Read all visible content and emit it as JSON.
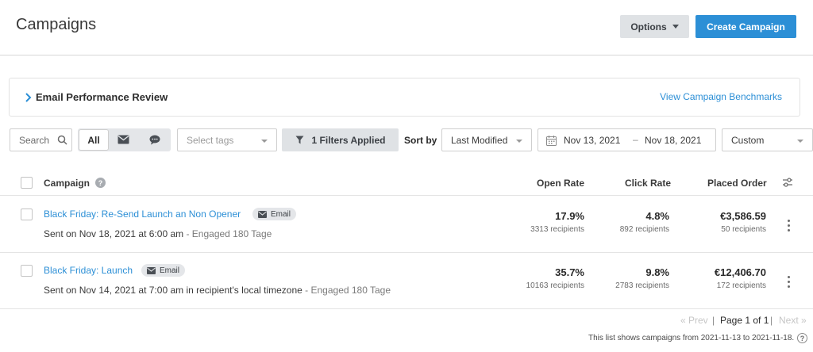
{
  "header": {
    "title": "Campaigns",
    "options_label": "Options",
    "create_label": "Create Campaign"
  },
  "performance": {
    "title": "Email Performance Review",
    "benchmarks_link": "View Campaign Benchmarks"
  },
  "toolbar": {
    "search_placeholder": "Search",
    "channel_all": "All",
    "tags_placeholder": "Select tags",
    "filters_label": "1 Filters Applied",
    "sort_label": "Sort by",
    "sort_value": "Last Modified",
    "date_from": "Nov 13, 2021",
    "date_sep": "–",
    "date_to": "Nov 18, 2021",
    "range_preset": "Custom"
  },
  "table": {
    "columns": {
      "campaign": "Campaign",
      "open_rate": "Open Rate",
      "click_rate": "Click Rate",
      "placed_order": "Placed Order"
    },
    "rows": [
      {
        "name": "Black Friday: Re-Send Launch an Non Opener",
        "channel": "Email",
        "sent": "Sent on Nov 18, 2021 at 6:00 am",
        "engaged": " - Engaged 180 Tage",
        "open_rate": "17.9%",
        "open_recipients": "3313 recipients",
        "click_rate": "4.8%",
        "click_recipients": "892 recipients",
        "placed_order": "€3,586.59",
        "order_recipients": "50 recipients"
      },
      {
        "name": "Black Friday: Launch",
        "channel": "Email",
        "sent": "Sent on Nov 14, 2021 at 7:00 am in recipient's local timezone",
        "engaged": " - Engaged 180 Tage",
        "open_rate": "35.7%",
        "open_recipients": "10163 recipients",
        "click_rate": "9.8%",
        "click_recipients": "2783 recipients",
        "placed_order": "€12,406.70",
        "order_recipients": "172 recipients"
      }
    ]
  },
  "pagination": {
    "prev": "« Prev",
    "page": "Page 1 of 1",
    "next": "Next »",
    "separator": "|"
  },
  "footnote": "This list shows campaigns from 2021-11-13 to 2021-11-18.",
  "colors": {
    "accent": "#2c8fd6",
    "button_gray": "#dfe2e5"
  }
}
